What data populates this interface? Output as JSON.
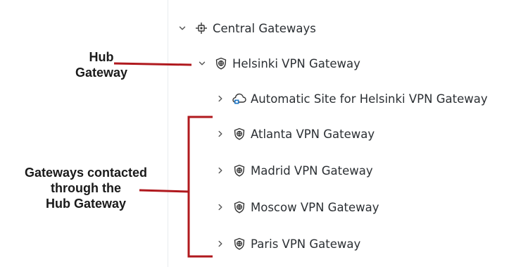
{
  "annotations": {
    "hub": {
      "line1": "Hub",
      "line2": "Gateway"
    },
    "contacted": {
      "line1": "Gateways contacted",
      "line2": "through the",
      "line3": "Hub Gateway"
    }
  },
  "tree": {
    "central": {
      "label": "Central Gateways",
      "icon": "central-gateways-icon",
      "expanded": true
    },
    "helsinki": {
      "label": "Helsinki VPN Gateway",
      "icon": "vpn-gateway-shield-icon",
      "expanded": true
    },
    "automatic_site": {
      "label": "Automatic Site for Helsinki VPN Gateway",
      "icon": "cloud-site-icon",
      "expanded": false
    },
    "atlanta": {
      "label": "Atlanta VPN Gateway",
      "icon": "vpn-gateway-shield-icon",
      "expanded": false
    },
    "madrid": {
      "label": "Madrid VPN Gateway",
      "icon": "vpn-gateway-shield-icon",
      "expanded": false
    },
    "moscow": {
      "label": "Moscow VPN Gateway",
      "icon": "vpn-gateway-shield-icon",
      "expanded": false
    },
    "paris": {
      "label": "Paris VPN Gateway",
      "icon": "vpn-gateway-shield-icon",
      "expanded": false
    }
  },
  "colors": {
    "annotation_line": "#b0191e",
    "text": "#2b2f33",
    "site_icon_accent": "#1f78c8"
  }
}
